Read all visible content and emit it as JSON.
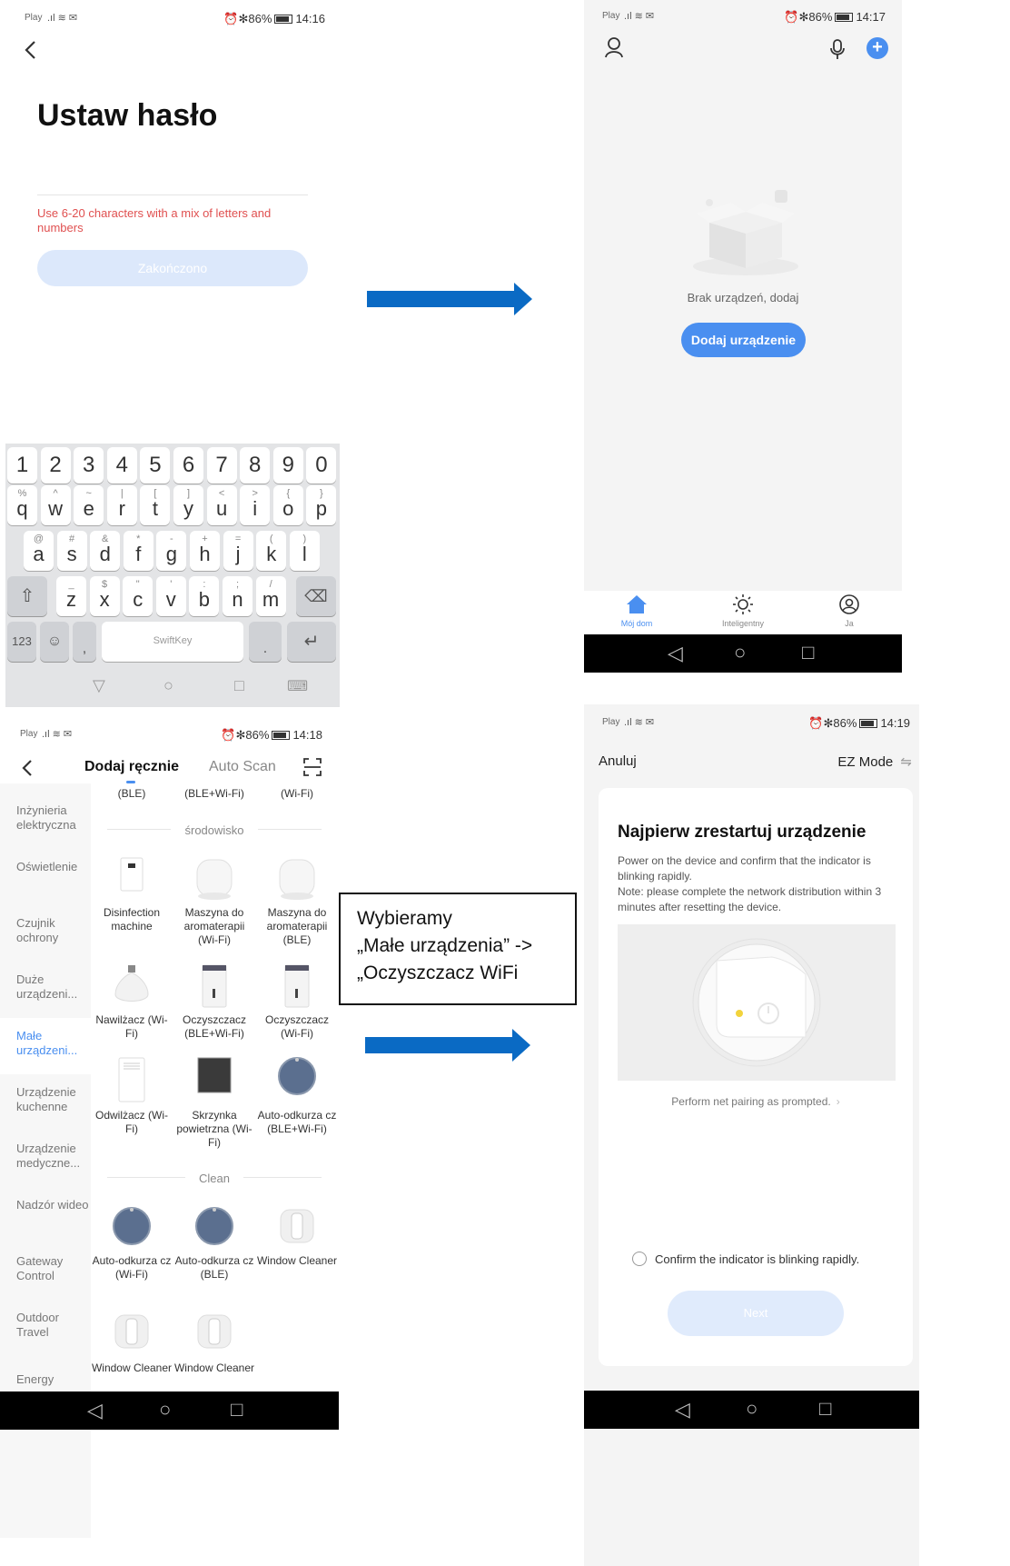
{
  "panel1": {
    "status_left": "Play",
    "status_right": "⏰✻86%",
    "status_time": "14:16",
    "back_icon": "chevron-left-icon",
    "title": "Ustaw hasło",
    "hint": "Use 6-20 characters with a mix of letters and numbers",
    "button": "Zakończono",
    "keyboard": {
      "numbers": [
        "1",
        "2",
        "3",
        "4",
        "5",
        "6",
        "7",
        "8",
        "9",
        "0"
      ],
      "row1": [
        [
          "%",
          "q"
        ],
        [
          "^",
          "w"
        ],
        [
          "~",
          "e"
        ],
        [
          "|",
          "r"
        ],
        [
          "[",
          "t"
        ],
        [
          "]",
          "y"
        ],
        [
          "<",
          "u"
        ],
        [
          ">",
          "i"
        ],
        [
          "{",
          "o"
        ],
        [
          "}",
          "p"
        ]
      ],
      "row2": [
        [
          "@",
          "a"
        ],
        [
          "#",
          "s"
        ],
        [
          "&",
          "d"
        ],
        [
          "*",
          "f"
        ],
        [
          "-",
          "g"
        ],
        [
          "+",
          "h"
        ],
        [
          "=",
          "j"
        ],
        [
          "(",
          "k"
        ],
        [
          ")",
          "l"
        ]
      ],
      "row3": [
        [
          "_",
          "z"
        ],
        [
          "$",
          "x"
        ],
        [
          "\"",
          "c"
        ],
        [
          "'",
          "v"
        ],
        [
          ":",
          "b"
        ],
        [
          ";",
          "n"
        ],
        [
          "/",
          "m"
        ]
      ],
      "key_123": "123",
      "space_label": "SwiftKey",
      "comma": ",",
      "period": "."
    }
  },
  "panel2": {
    "status_left": "Play",
    "status_right": "⏰✻86%",
    "status_time": "14:17",
    "empty_text": "Brak urządzeń, dodaj",
    "add_button": "Dodaj urządzenie",
    "tabs": [
      {
        "label": "Mój dom",
        "icon": "home-icon",
        "active": true
      },
      {
        "label": "Inteligentny",
        "icon": "sun-icon",
        "active": false
      },
      {
        "label": "Ja",
        "icon": "user-circle-icon",
        "active": false
      }
    ]
  },
  "panel3": {
    "status_left": "Play",
    "status_right": "⏰✻86%",
    "status_time": "14:18",
    "tab_active": "Dodaj ręcznie",
    "tab_inactive": "Auto Scan",
    "top_labels": [
      "(BLE)",
      "(BLE+Wi-Fi)",
      "(Wi-Fi)"
    ],
    "section1": "środowisko",
    "section2": "Clean",
    "categories": [
      "Inżynieria elektryczna",
      "Oświetlenie",
      "Czujnik ochrony",
      "Duże urządzeni...",
      "Małe urządzeni...",
      "Urządzenie kuchenne",
      "Urządzenie medyczne...",
      "Nadzór wideo",
      "Gateway Control",
      "Outdoor Travel",
      "Energy"
    ],
    "active_category_index": 4,
    "devices": [
      "Disinfection machine",
      "Maszyna do aromaterapii (Wi-Fi)",
      "Maszyna do aromaterapii (BLE)",
      "Nawilżacz (Wi-Fi)",
      "Oczyszczacz (BLE+Wi-Fi)",
      "Oczyszczacz (Wi-Fi)",
      "Odwilżacz (Wi-Fi)",
      "Skrzynka powietrzna (Wi-Fi)",
      "Auto-odkurza cz (BLE+Wi-Fi)",
      "Auto-odkurza cz (Wi-Fi)",
      "Auto-odkurza cz (BLE)",
      "Window Cleaner",
      "Window Cleaner",
      "Window Cleaner"
    ]
  },
  "panel4": {
    "status_left": "Play",
    "status_right": "⏰✻86%",
    "status_time": "14:19",
    "cancel": "Anuluj",
    "mode": "EZ Mode",
    "title": "Najpierw zrestartuj urządzenie",
    "desc": "Power on the device and confirm that the indicator is blinking rapidly.",
    "note": "Note: please complete the network distribution within 3 minutes after resetting the device.",
    "prompt_link": "Perform net pairing as prompted.",
    "confirm": "Confirm the indicator is blinking rapidly.",
    "next": "Next"
  },
  "callout": {
    "line1": "Wybieramy",
    "line2": "„Małe urządzenia” ->",
    "line3": "„Oczyszczacz WiFi"
  },
  "colors": {
    "accent": "#4a8ff0",
    "arrow": "#0a6ac4",
    "hint_red": "#e05050"
  }
}
